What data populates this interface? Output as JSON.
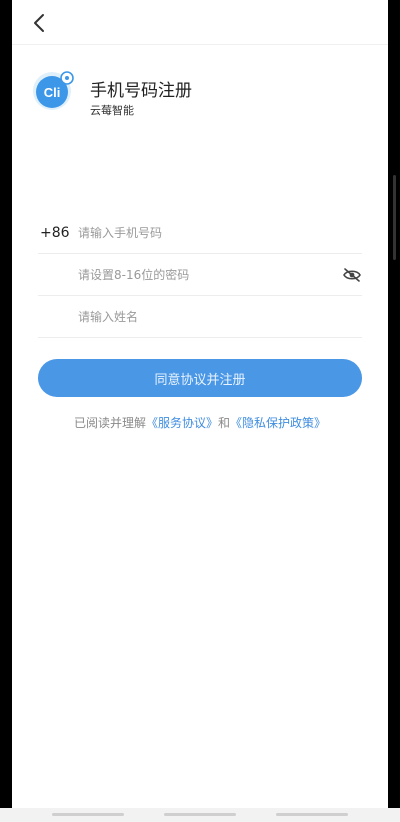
{
  "header": {
    "title": "手机号码注册",
    "subtitle": "云莓智能",
    "back_icon": "chevron-left-icon"
  },
  "logo": {
    "text": "Cli",
    "accent": "#3d97e8"
  },
  "form": {
    "country_code": "+86",
    "phone_placeholder": "请输入手机号码",
    "password_placeholder": "请设置8-16位的密码",
    "name_placeholder": "请输入姓名",
    "password_toggle_icon": "eye-off-icon"
  },
  "actions": {
    "register_label": "同意协议并注册",
    "accent": "#4a97e6"
  },
  "agreement": {
    "prefix": "已阅读并理解",
    "service_link": "《服务协议》",
    "connector": "和",
    "privacy_link": "《隐私保护政策》"
  }
}
